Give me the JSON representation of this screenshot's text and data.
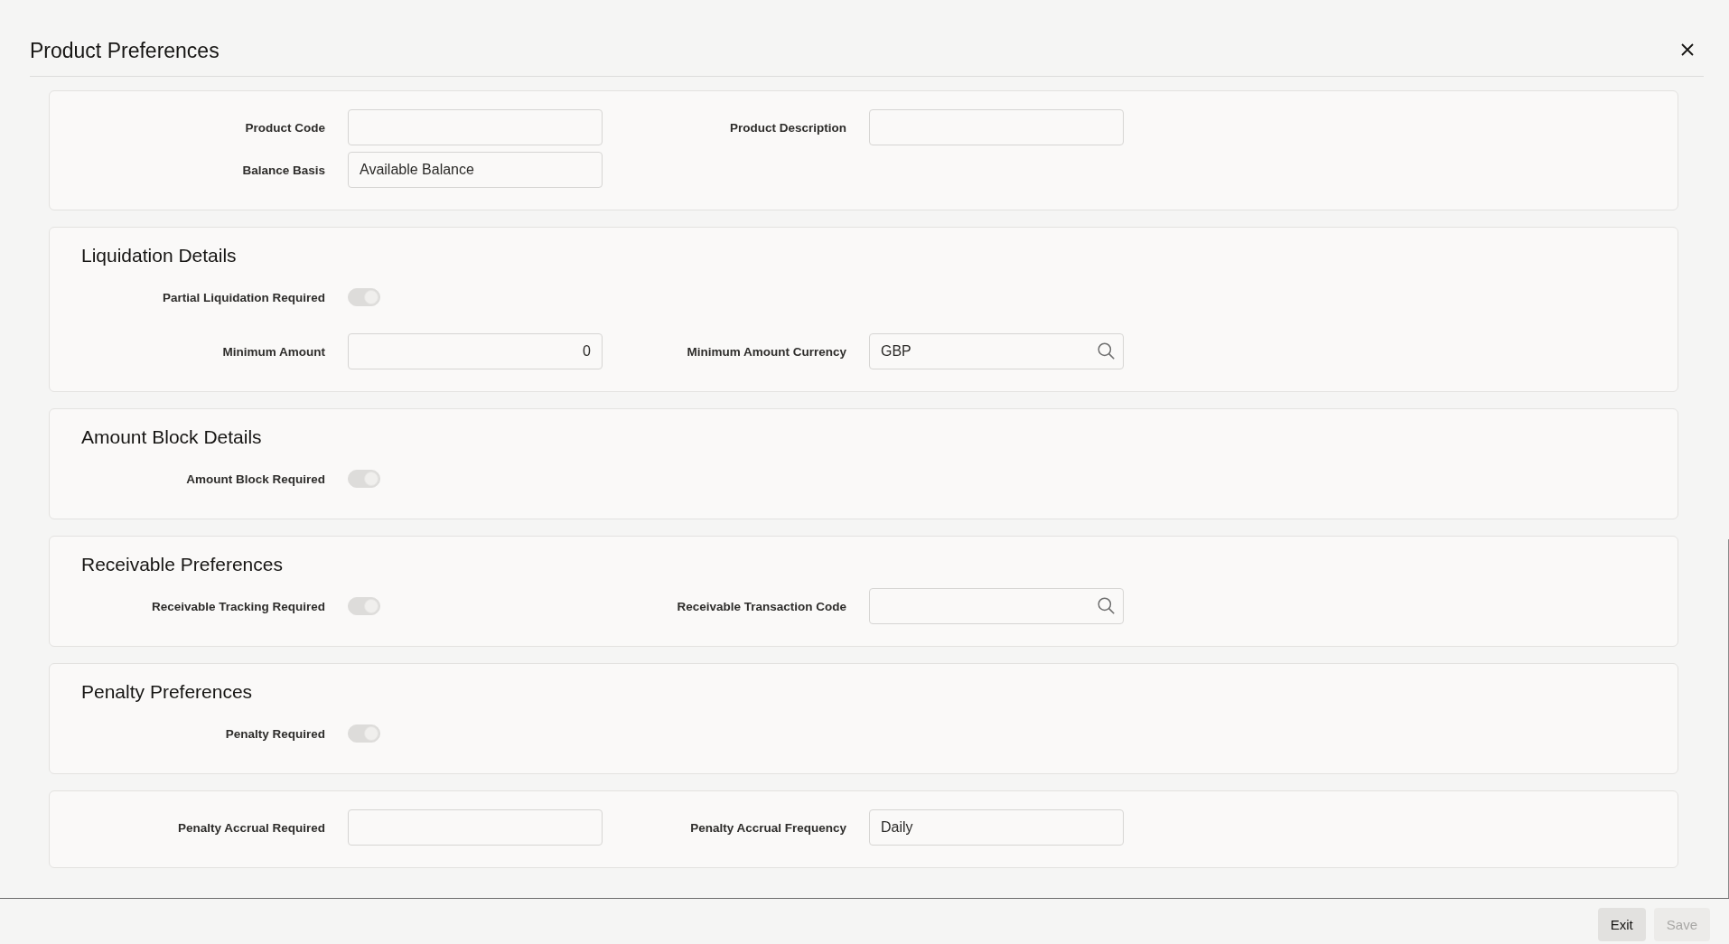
{
  "dialog": {
    "title": "Product Preferences"
  },
  "sections": [
    {
      "rows": [
        {
          "fields": [
            {
              "kind": "text",
              "label": "Product Code"
            },
            {
              "kind": "text",
              "label": "Product Description"
            }
          ]
        },
        {
          "fields": [
            {
              "kind": "text",
              "label": "Balance Basis",
              "value": "Available Balance"
            }
          ]
        }
      ]
    },
    {
      "heading": "Liquidation Details",
      "rows": [
        {
          "fields": [
            {
              "kind": "toggle",
              "label": "Partial Liquidation Required",
              "on": true,
              "disabled": true
            }
          ]
        },
        {
          "fields": [
            {
              "kind": "number",
              "label": "Minimum Amount",
              "value": "0"
            },
            {
              "kind": "lookup",
              "label": "Minimum Amount Currency",
              "value": "GBP"
            }
          ]
        }
      ]
    },
    {
      "heading": "Amount Block Details",
      "rows": [
        {
          "fields": [
            {
              "kind": "toggle",
              "label": "Amount Block Required",
              "on": true,
              "disabled": true
            }
          ]
        }
      ]
    },
    {
      "heading": "Receivable Preferences",
      "rows": [
        {
          "fields": [
            {
              "kind": "toggle",
              "label": "Receivable Tracking Required",
              "on": true,
              "disabled": true
            },
            {
              "kind": "lookup",
              "label": "Receivable Transaction Code"
            }
          ]
        }
      ]
    },
    {
      "heading": "Penalty Preferences",
      "rows": [
        {
          "fields": [
            {
              "kind": "toggle",
              "label": "Penalty Required",
              "on": true,
              "disabled": true
            }
          ]
        }
      ]
    },
    {
      "rows": [
        {
          "fields": [
            {
              "kind": "text",
              "label": "Penalty Accrual Required"
            },
            {
              "kind": "text",
              "label": "Penalty Accrual Frequency",
              "value": "Daily"
            }
          ]
        }
      ]
    }
  ],
  "buttons": [
    {
      "label": "Exit",
      "disabled": false
    },
    {
      "label": "Save",
      "disabled": true
    }
  ]
}
